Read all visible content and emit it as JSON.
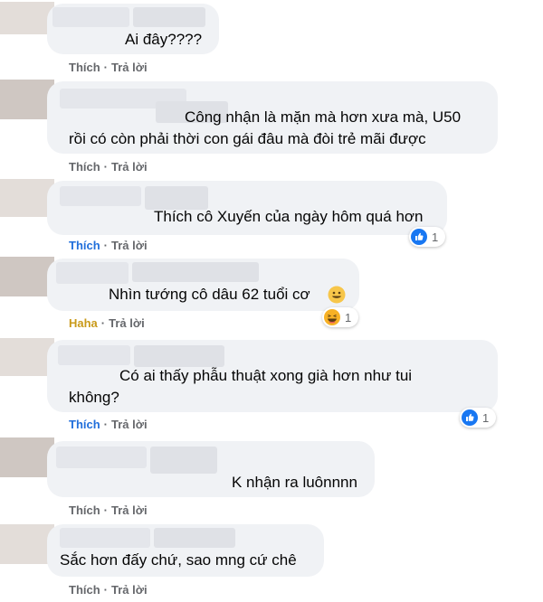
{
  "comments": [
    {
      "text_lines": [
        "Ai đây????"
      ],
      "actions": {
        "like": "Thích",
        "reply": "Trả lời"
      }
    },
    {
      "text_lines": [
        "Công nhận là mặn mà hơn xưa mà, U50",
        "rồi có còn phải thời con gái đâu mà đòi trẻ mãi được"
      ],
      "actions": {
        "like": "Thích",
        "reply": "Trả lời"
      }
    },
    {
      "text_lines": [
        "Thích cô Xuyến của ngày hôm quá hơn"
      ],
      "actions": {
        "like": "Thích",
        "reply": "Trả lời"
      },
      "reaction": {
        "icon": "like-reaction-icon",
        "count": "1"
      }
    },
    {
      "text_lines": [
        "Nhìn tướng cô dâu 62 tuổi cơ"
      ],
      "inline_emoji": "smile-emoji-icon",
      "actions": {
        "like": "Haha",
        "reply": "Trả lời"
      },
      "reaction": {
        "icon": "haha-reaction-icon",
        "count": "1"
      }
    },
    {
      "text_lines": [
        "Có ai thấy phẫu thuật xong già hơn như tui",
        "không?"
      ],
      "actions": {
        "like": "Thích",
        "reply": "Trả lời"
      },
      "reaction": {
        "icon": "like-reaction-icon",
        "count": "1"
      }
    },
    {
      "text_lines": [
        "K nhận ra luônnnn"
      ],
      "actions": {
        "like": "Thích",
        "reply": "Trả lời"
      }
    },
    {
      "text_lines": [
        "Sắc hơn đấy chứ, sao mng cứ chê"
      ],
      "actions": {
        "like": "Thích",
        "reply": "Trả lời"
      }
    }
  ],
  "colors": {
    "like_blue": "#216fdb",
    "haha_yellow": "#c99a1a",
    "action_gray": "#65676b",
    "bubble": "#f0f2f5"
  }
}
